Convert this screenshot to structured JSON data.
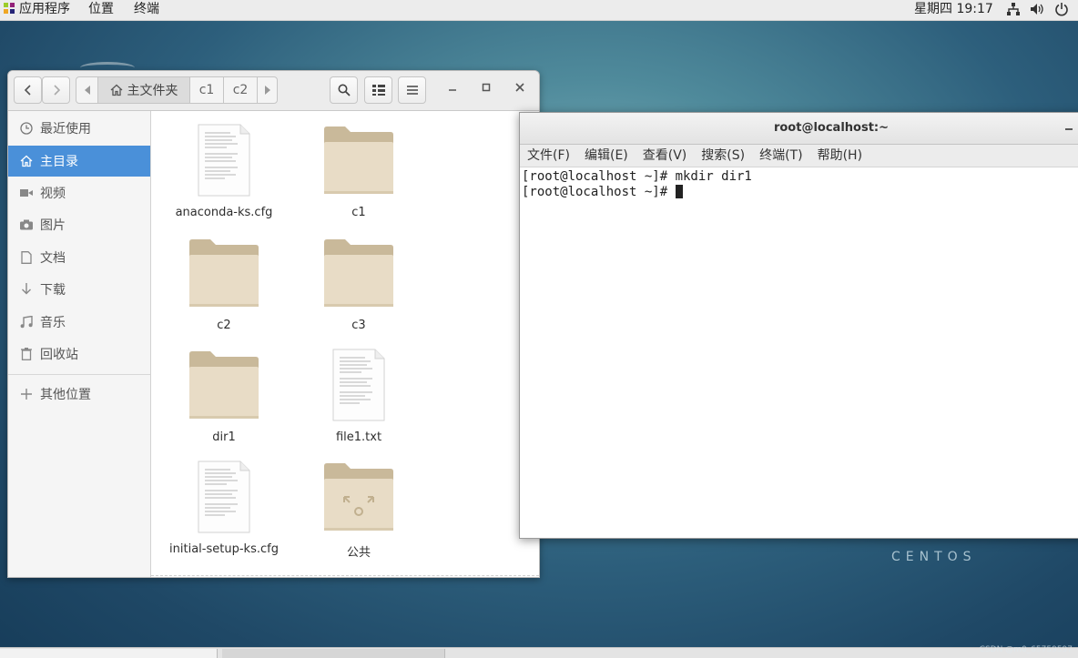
{
  "topbar": {
    "apps_label": "应用程序",
    "places_label": "位置",
    "terminal_label": "终端",
    "clock": "星期四 19:17"
  },
  "desktop": {
    "brand_text": "CENTOS",
    "watermark": "CSDN @m0_65759597"
  },
  "file_manager": {
    "breadcrumbs": [
      "主文件夹",
      "c1",
      "c2"
    ],
    "sidebar": {
      "items": [
        {
          "label": "最近使用",
          "icon": "clock-icon"
        },
        {
          "label": "主目录",
          "icon": "home-icon",
          "active": true
        },
        {
          "label": "视频",
          "icon": "video-icon"
        },
        {
          "label": "图片",
          "icon": "camera-icon"
        },
        {
          "label": "文档",
          "icon": "document-icon"
        },
        {
          "label": "下载",
          "icon": "download-icon"
        },
        {
          "label": "音乐",
          "icon": "music-icon"
        },
        {
          "label": "回收站",
          "icon": "trash-icon"
        }
      ],
      "other": {
        "label": "其他位置",
        "icon": "plus-icon"
      }
    },
    "files": [
      {
        "name": "anaconda-ks.cfg",
        "type": "text"
      },
      {
        "name": "c1",
        "type": "folder"
      },
      {
        "name": "c2",
        "type": "folder"
      },
      {
        "name": "c3",
        "type": "folder"
      },
      {
        "name": "dir1",
        "type": "folder"
      },
      {
        "name": "file1.txt",
        "type": "text"
      },
      {
        "name": "initial-setup-ks.cfg",
        "type": "text"
      },
      {
        "name": "公共",
        "type": "shared-folder"
      }
    ]
  },
  "terminal": {
    "title": "root@localhost:~",
    "menu": [
      "文件(F)",
      "编辑(E)",
      "查看(V)",
      "搜索(S)",
      "终端(T)",
      "帮助(H)"
    ],
    "lines": [
      "[root@localhost ~]# mkdir dir1",
      "[root@localhost ~]# "
    ]
  },
  "colors": {
    "accent": "#4a90d9",
    "folder": "#e8dcc6",
    "folder_tab": "#c9b99a"
  }
}
